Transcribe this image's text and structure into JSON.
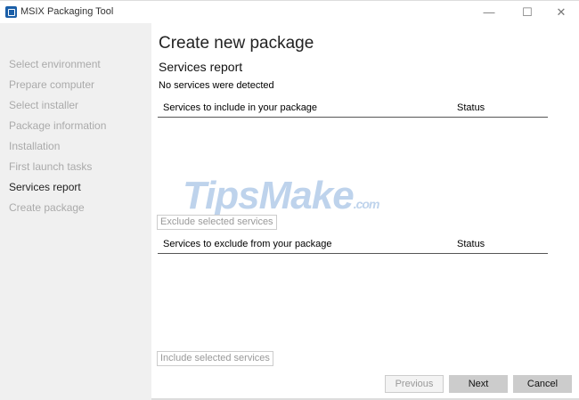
{
  "window": {
    "title": "MSIX Packaging Tool",
    "controls": {
      "minimize": "—",
      "maximize": "☐",
      "close": "✕"
    }
  },
  "sidebar": {
    "items": [
      {
        "label": "Select environment",
        "active": false
      },
      {
        "label": "Prepare computer",
        "active": false
      },
      {
        "label": "Select installer",
        "active": false
      },
      {
        "label": "Package information",
        "active": false
      },
      {
        "label": "Installation",
        "active": false
      },
      {
        "label": "First launch tasks",
        "active": false
      },
      {
        "label": "Services report",
        "active": true
      },
      {
        "label": "Create package",
        "active": false
      }
    ]
  },
  "main": {
    "title": "Create new package",
    "subtitle": "Services report",
    "note": "No services were detected",
    "include_table": {
      "col1": "Services to include in your package",
      "col2": "Status",
      "rows": []
    },
    "exclude_button": "Exclude selected services",
    "exclude_table": {
      "col1": "Services to exclude from your package",
      "col2": "Status",
      "rows": []
    },
    "include_button": "Include selected services"
  },
  "footer": {
    "previous": "Previous",
    "next": "Next",
    "cancel": "Cancel"
  },
  "watermark": "TipsMake.com"
}
